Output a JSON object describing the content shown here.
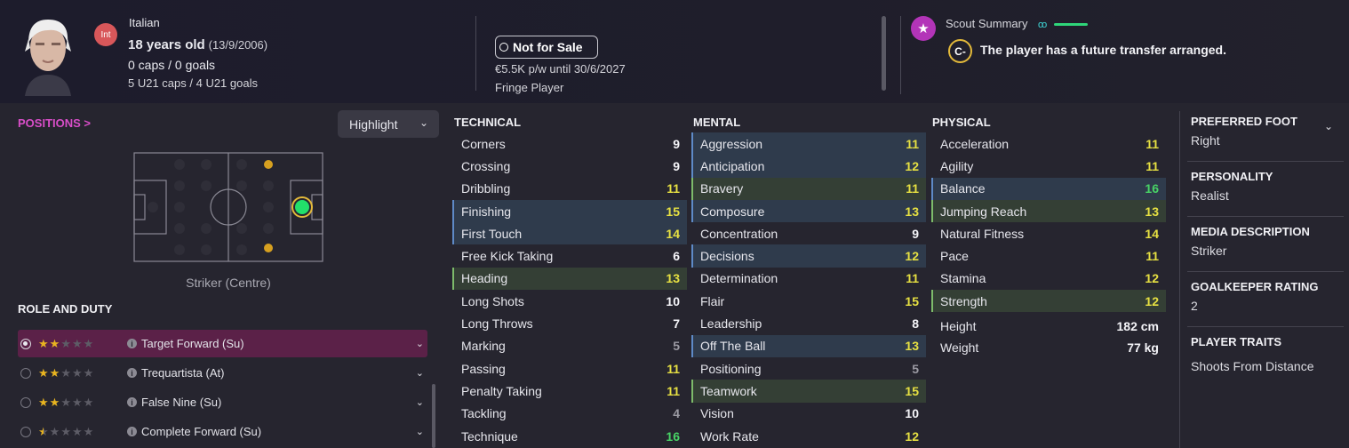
{
  "header": {
    "nationality": "Italian",
    "intl_badge": "Int",
    "age_text": "18 years old",
    "dob": "(13/9/2006)",
    "caps_goals": "0 caps / 0 goals",
    "u21_caps_goals": "5 U21 caps / 4 U21 goals",
    "transfer_status": "Not for Sale",
    "wage_contract": "€5.5K p/w until 30/6/2027",
    "squad_status": "Fringe Player",
    "scout_title": "Scout Summary",
    "scout_grade": "C-",
    "scout_message": "The player has a future transfer arranged."
  },
  "left": {
    "positions_label": "POSITIONS >",
    "highlight_label": "Highlight",
    "position_name": "Striker (Centre)",
    "role_title": "ROLE AND DUTY",
    "roles": [
      {
        "name": "Target Forward (Su)",
        "stars": 2,
        "selected": true
      },
      {
        "name": "Trequartista (At)",
        "stars": 2,
        "selected": false
      },
      {
        "name": "False Nine (Su)",
        "stars": 2,
        "selected": false
      },
      {
        "name": "Complete Forward (Su)",
        "stars": 0.5,
        "selected": false
      }
    ]
  },
  "attributes": {
    "technical": {
      "title": "TECHNICAL",
      "rows": [
        {
          "name": "Corners",
          "value": "9",
          "color": "white",
          "hl": ""
        },
        {
          "name": "Crossing",
          "value": "9",
          "color": "white",
          "hl": ""
        },
        {
          "name": "Dribbling",
          "value": "11",
          "color": "yellow",
          "hl": ""
        },
        {
          "name": "Finishing",
          "value": "15",
          "color": "yellow",
          "hl": "blue"
        },
        {
          "name": "First Touch",
          "value": "14",
          "color": "yellow",
          "hl": "blue"
        },
        {
          "name": "Free Kick Taking",
          "value": "6",
          "color": "white",
          "hl": ""
        },
        {
          "name": "Heading",
          "value": "13",
          "color": "yellow",
          "hl": "green"
        },
        {
          "name": "Long Shots",
          "value": "10",
          "color": "white",
          "hl": ""
        },
        {
          "name": "Long Throws",
          "value": "7",
          "color": "white",
          "hl": ""
        },
        {
          "name": "Marking",
          "value": "5",
          "color": "grey",
          "hl": ""
        },
        {
          "name": "Passing",
          "value": "11",
          "color": "yellow",
          "hl": ""
        },
        {
          "name": "Penalty Taking",
          "value": "11",
          "color": "yellow",
          "hl": ""
        },
        {
          "name": "Tackling",
          "value": "4",
          "color": "grey",
          "hl": ""
        },
        {
          "name": "Technique",
          "value": "16",
          "color": "green",
          "hl": ""
        }
      ]
    },
    "mental": {
      "title": "MENTAL",
      "rows": [
        {
          "name": "Aggression",
          "value": "11",
          "color": "yellow",
          "hl": "blue"
        },
        {
          "name": "Anticipation",
          "value": "12",
          "color": "yellow",
          "hl": "blue"
        },
        {
          "name": "Bravery",
          "value": "11",
          "color": "yellow",
          "hl": "green"
        },
        {
          "name": "Composure",
          "value": "13",
          "color": "yellow",
          "hl": "blue"
        },
        {
          "name": "Concentration",
          "value": "9",
          "color": "white",
          "hl": ""
        },
        {
          "name": "Decisions",
          "value": "12",
          "color": "yellow",
          "hl": "blue"
        },
        {
          "name": "Determination",
          "value": "11",
          "color": "yellow",
          "hl": ""
        },
        {
          "name": "Flair",
          "value": "15",
          "color": "yellow",
          "hl": ""
        },
        {
          "name": "Leadership",
          "value": "8",
          "color": "white",
          "hl": ""
        },
        {
          "name": "Off The Ball",
          "value": "13",
          "color": "yellow",
          "hl": "blue"
        },
        {
          "name": "Positioning",
          "value": "5",
          "color": "grey",
          "hl": ""
        },
        {
          "name": "Teamwork",
          "value": "15",
          "color": "yellow",
          "hl": "green"
        },
        {
          "name": "Vision",
          "value": "10",
          "color": "white",
          "hl": ""
        },
        {
          "name": "Work Rate",
          "value": "12",
          "color": "yellow",
          "hl": ""
        }
      ]
    },
    "physical": {
      "title": "PHYSICAL",
      "rows": [
        {
          "name": "Acceleration",
          "value": "11",
          "color": "yellow",
          "hl": ""
        },
        {
          "name": "Agility",
          "value": "11",
          "color": "yellow",
          "hl": ""
        },
        {
          "name": "Balance",
          "value": "16",
          "color": "green",
          "hl": "blue"
        },
        {
          "name": "Jumping Reach",
          "value": "13",
          "color": "yellow",
          "hl": "green"
        },
        {
          "name": "Natural Fitness",
          "value": "14",
          "color": "yellow",
          "hl": ""
        },
        {
          "name": "Pace",
          "value": "11",
          "color": "yellow",
          "hl": ""
        },
        {
          "name": "Stamina",
          "value": "12",
          "color": "yellow",
          "hl": ""
        },
        {
          "name": "Strength",
          "value": "12",
          "color": "yellow",
          "hl": "green"
        }
      ],
      "height_label": "Height",
      "height_value": "182 cm",
      "weight_label": "Weight",
      "weight_value": "77 kg"
    }
  },
  "info": {
    "foot_label": "PREFERRED FOOT",
    "foot_value": "Right",
    "personality_label": "PERSONALITY",
    "personality_value": "Realist",
    "media_label": "MEDIA DESCRIPTION",
    "media_value": "Striker",
    "gk_label": "GOALKEEPER RATING",
    "gk_value": "2",
    "traits_label": "PLAYER TRAITS",
    "traits_value": "Shoots From Distance"
  },
  "colors": {
    "accent_pink": "#d94ec9",
    "role_selected": "#5b2148",
    "highlight_blue": "#2f3b4c",
    "highlight_green": "#343f35",
    "value_yellow": "#e6e042",
    "value_green": "#48d366"
  }
}
